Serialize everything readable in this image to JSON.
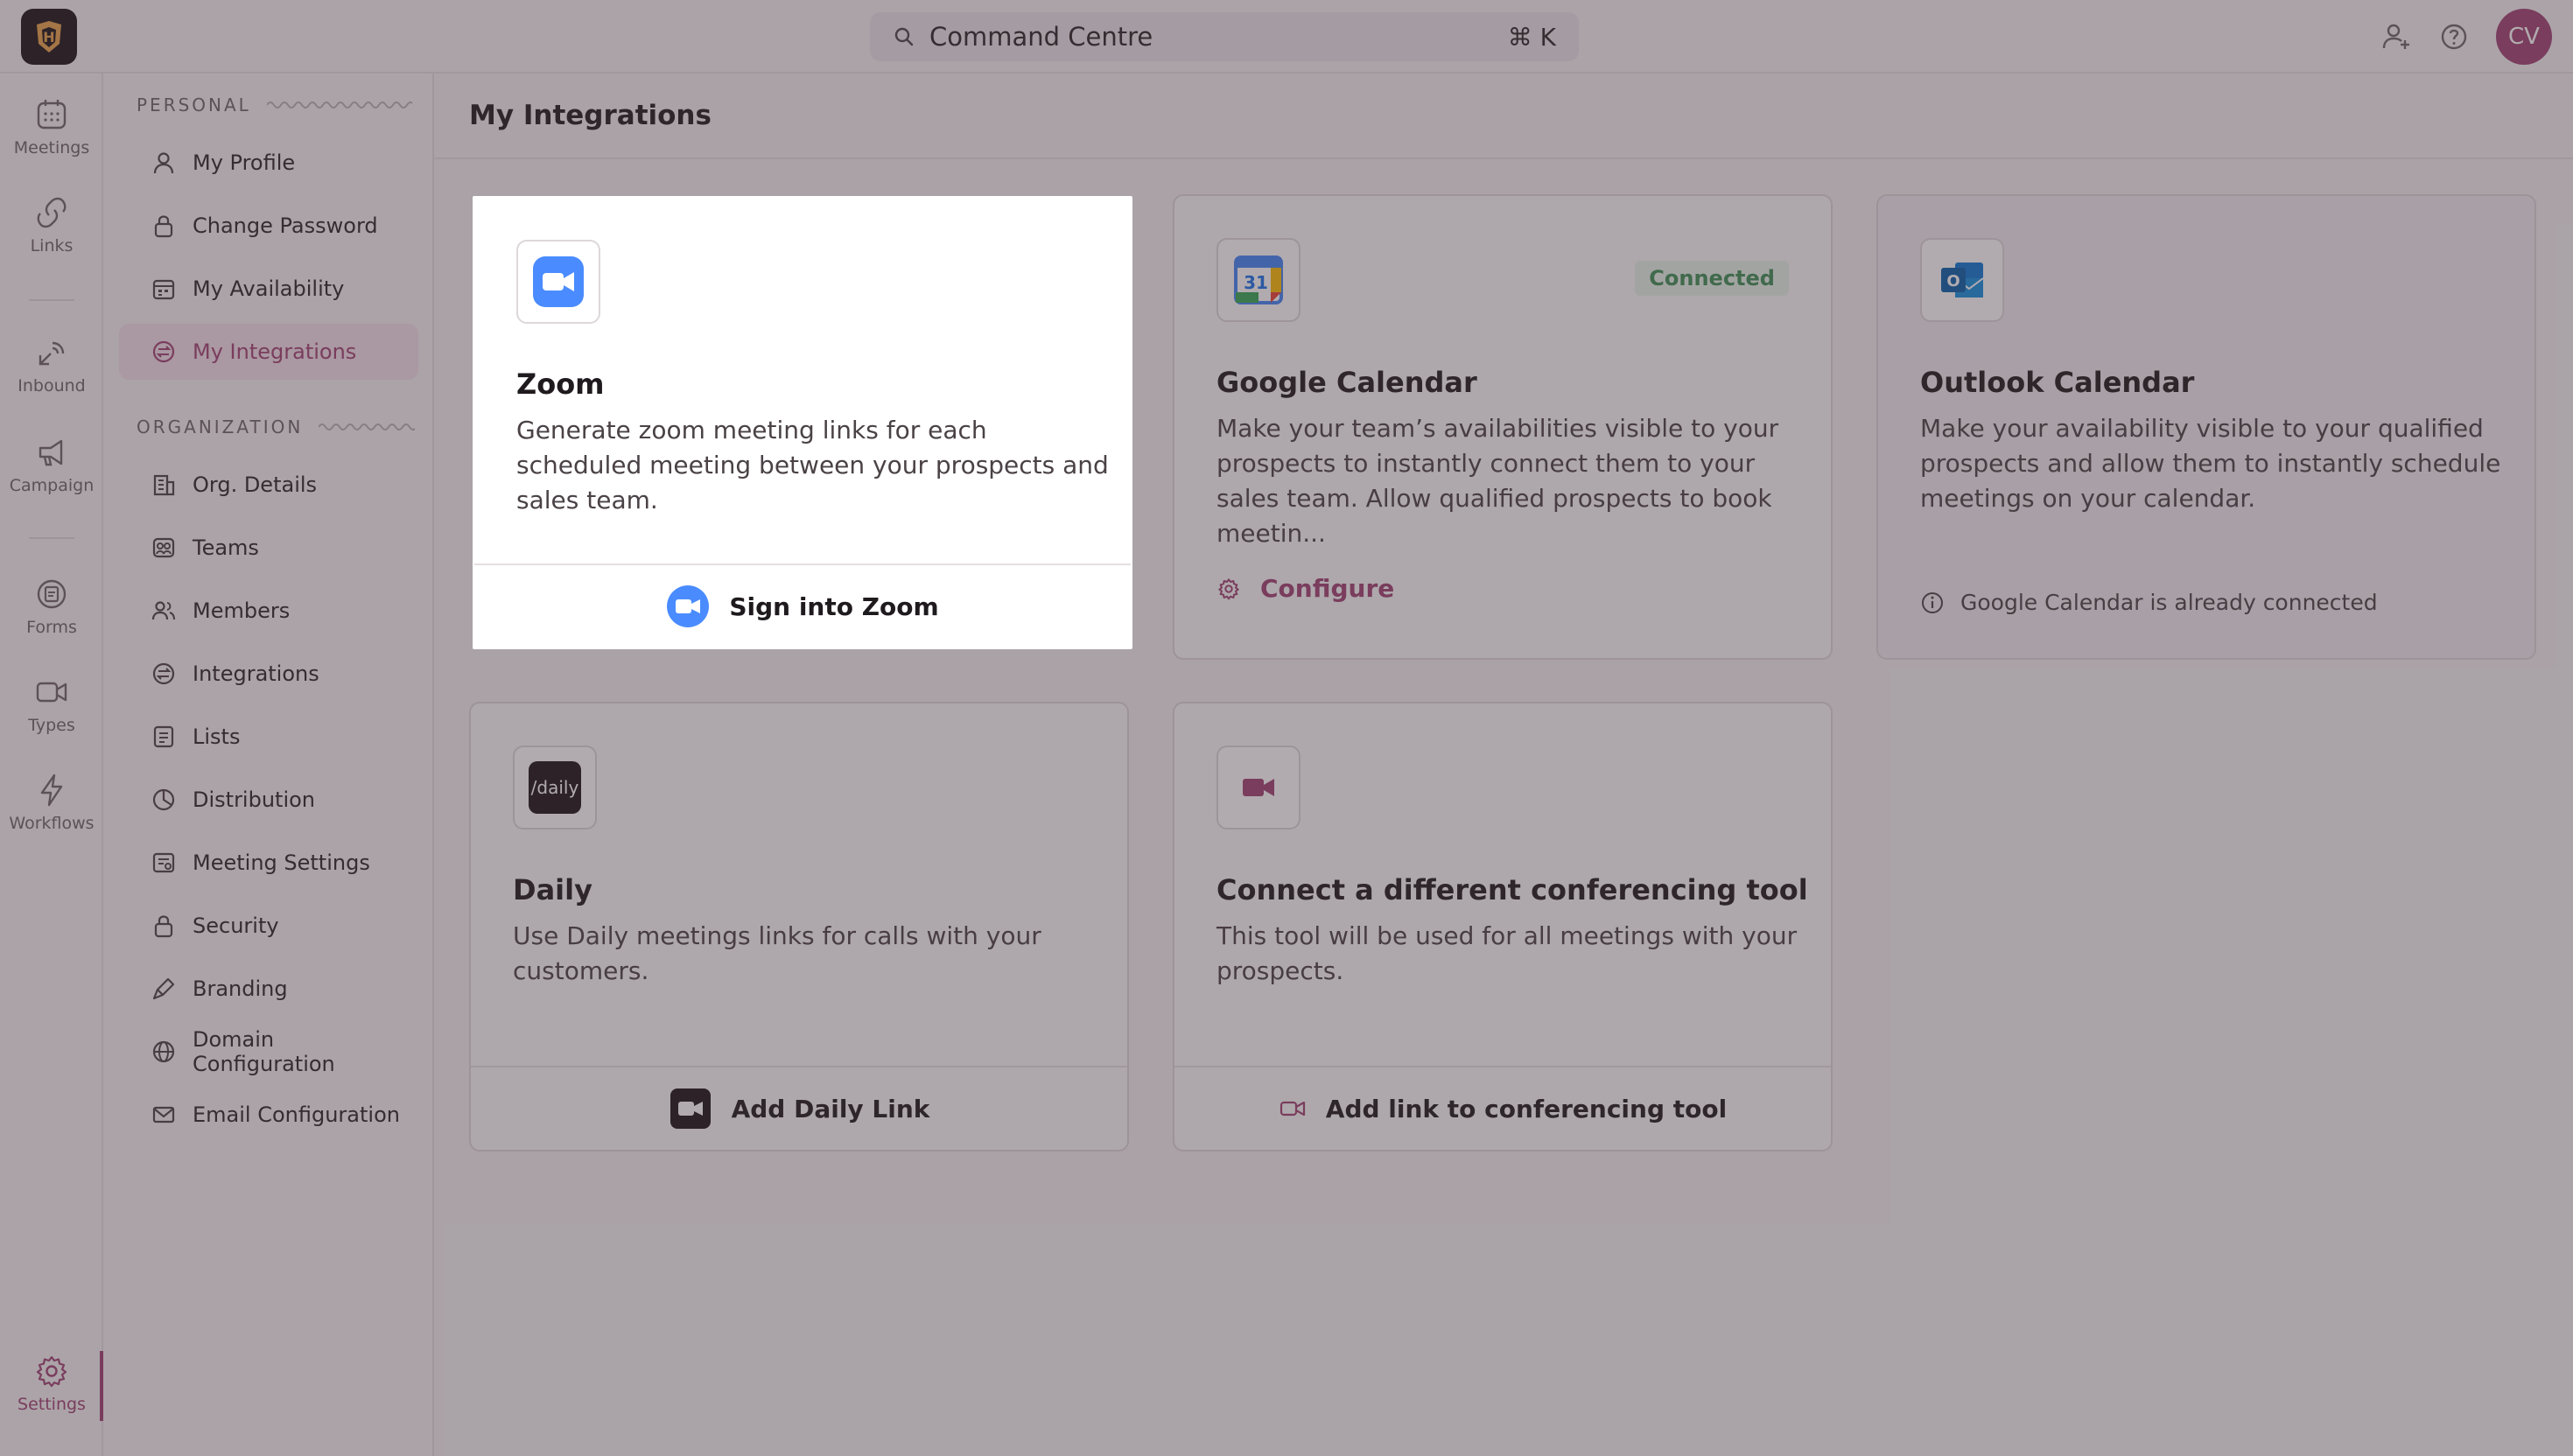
{
  "header": {
    "search_label": "Command Centre",
    "search_shortcut": "⌘ K",
    "icons": [
      "add-user-icon",
      "help-icon"
    ],
    "avatar_initials": "CV"
  },
  "rail": {
    "items": [
      {
        "label": "Meetings",
        "icon": "calendar-icon"
      },
      {
        "label": "Links",
        "icon": "link-icon"
      },
      {
        "label": "Inbound",
        "icon": "inbound-icon"
      },
      {
        "label": "Campaign",
        "icon": "megaphone-icon"
      },
      {
        "label": "Forms",
        "icon": "forms-icon"
      },
      {
        "label": "Types",
        "icon": "video-types-icon"
      },
      {
        "label": "Workflows",
        "icon": "lightning-icon"
      },
      {
        "label": "Settings",
        "icon": "gear-icon",
        "active": true
      }
    ]
  },
  "sidebar": {
    "personal_heading": "PERSONAL",
    "personal_items": [
      {
        "label": "My Profile",
        "icon": "user-icon"
      },
      {
        "label": "Change Password",
        "icon": "lock-icon"
      },
      {
        "label": "My Availability",
        "icon": "calendar-grid-icon"
      },
      {
        "label": "My Integrations",
        "icon": "integrations-icon",
        "active": true
      }
    ],
    "org_heading": "ORGANIZATION",
    "org_items": [
      {
        "label": "Org. Details",
        "icon": "building-icon"
      },
      {
        "label": "Teams",
        "icon": "teams-icon"
      },
      {
        "label": "Members",
        "icon": "members-icon"
      },
      {
        "label": "Integrations",
        "icon": "integrations-icon"
      },
      {
        "label": "Lists",
        "icon": "list-icon"
      },
      {
        "label": "Distribution",
        "icon": "pie-icon"
      },
      {
        "label": "Meeting Settings",
        "icon": "meeting-settings-icon"
      },
      {
        "label": "Security",
        "icon": "lock-icon"
      },
      {
        "label": "Branding",
        "icon": "brush-icon"
      },
      {
        "label": "Domain Configuration",
        "icon": "globe-icon"
      },
      {
        "label": "Email Configuration",
        "icon": "mail-icon"
      }
    ]
  },
  "main": {
    "title": "My Integrations",
    "cards": {
      "zoom": {
        "title": "Zoom",
        "description": "Generate zoom meeting links for each scheduled meeting between your prospects and sales team.",
        "action": "Sign into Zoom"
      },
      "google": {
        "title": "Google Calendar",
        "badge": "Connected",
        "description": "Make your team’s availabilities visible to your prospects to instantly connect them to your sales team. Allow qualified prospects to book meetin...",
        "action": "Configure"
      },
      "outlook": {
        "title": "Outlook Calendar",
        "description": "Make your availability visible to your qualified prospects and allow them to instantly schedule meetings on your calendar.",
        "note": "Google Calendar is already connected"
      },
      "daily": {
        "title": "Daily",
        "logo_text": "/daily",
        "description": "Use Daily meetings links for calls with your customers.",
        "action": "Add Daily Link"
      },
      "other": {
        "title": "Connect a different conferencing tool",
        "description": "This tool will be used for all meetings with your prospects.",
        "action": "Add link to conferencing tool"
      }
    }
  },
  "colors": {
    "accent": "#a04372",
    "connected_text": "#3f8f55",
    "zoom_blue": "#4a8cff"
  }
}
